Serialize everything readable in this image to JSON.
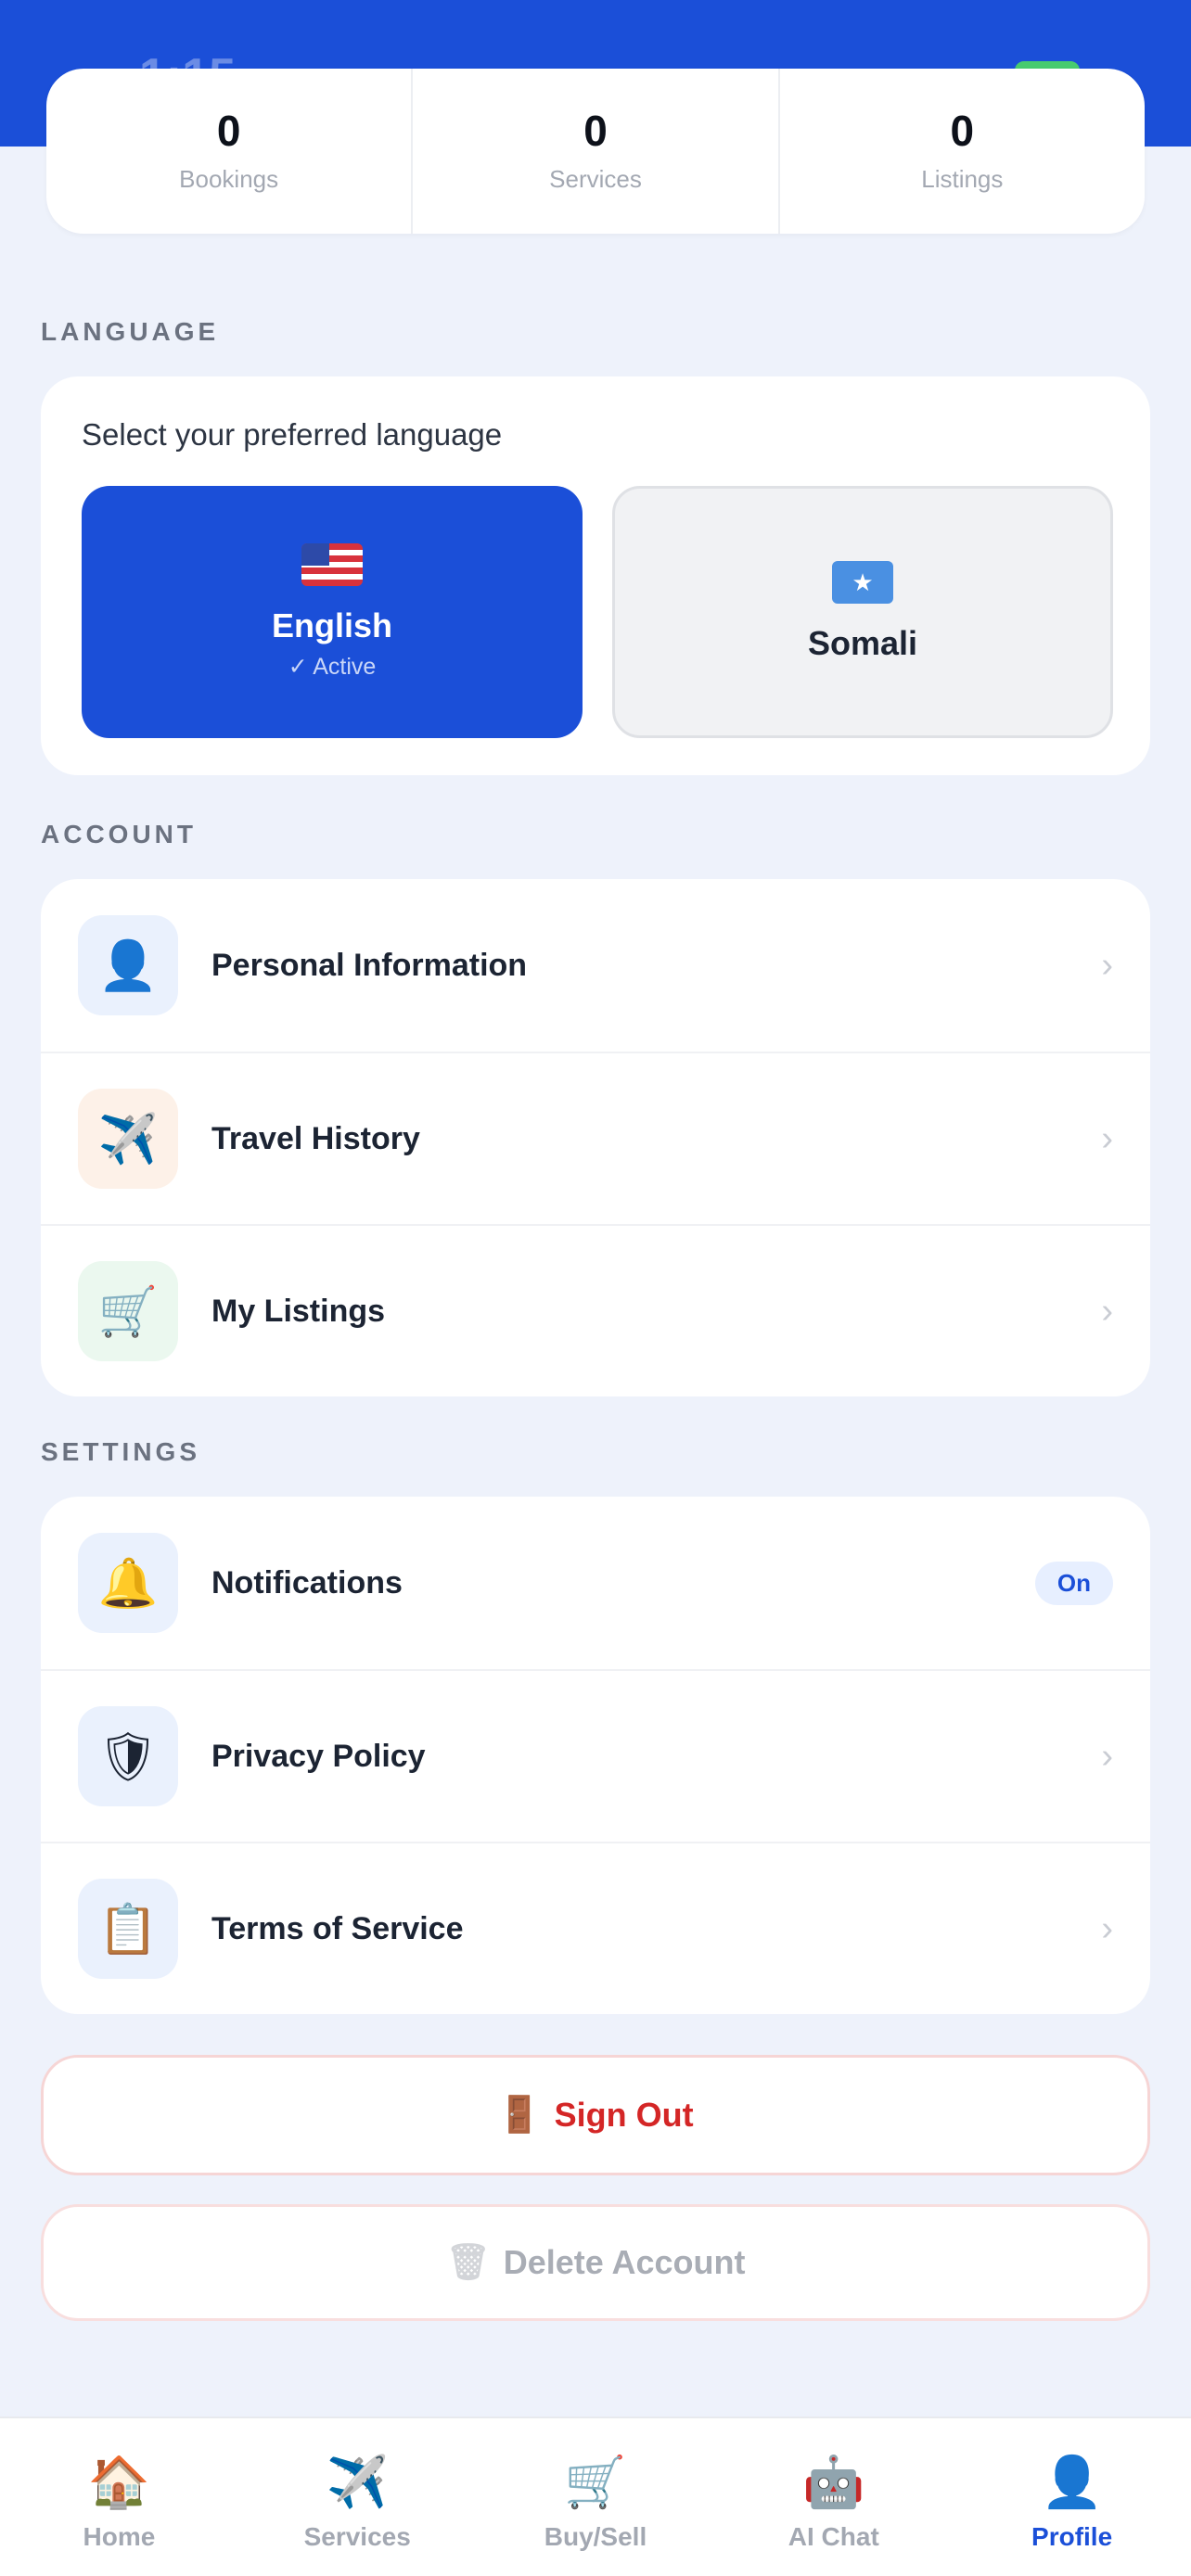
{
  "status_bar": {
    "time": "1:15"
  },
  "stats": [
    {
      "value": "0",
      "label": "Bookings"
    },
    {
      "value": "0",
      "label": "Services"
    },
    {
      "value": "0",
      "label": "Listings"
    }
  ],
  "language": {
    "section_label": "LANGUAGE",
    "prompt": "Select your preferred language",
    "options": [
      {
        "name": "English",
        "status": "✓ Active",
        "flag": "us-flag-icon"
      },
      {
        "name": "Somali",
        "flag": "somalia-flag-icon"
      }
    ]
  },
  "account": {
    "section_label": "ACCOUNT",
    "items": [
      {
        "label": "Personal Information",
        "icon": "👤",
        "icon_name": "person-icon"
      },
      {
        "label": "Travel History",
        "icon": "✈️",
        "icon_name": "airplane-icon"
      },
      {
        "label": "My Listings",
        "icon": "🛒",
        "icon_name": "cart-icon"
      }
    ]
  },
  "settings": {
    "section_label": "SETTINGS",
    "items": [
      {
        "label": "Notifications",
        "icon": "🔔",
        "icon_name": "bell-icon",
        "badge": "On"
      },
      {
        "label": "Privacy Policy",
        "icon": "🛡",
        "icon_name": "shield-icon"
      },
      {
        "label": "Terms of Service",
        "icon": "📋",
        "icon_name": "clipboard-icon"
      }
    ]
  },
  "actions": {
    "sign_out": {
      "label": "Sign Out",
      "icon": "🚪"
    },
    "delete_account": {
      "label": "Delete Account",
      "icon": "🗑"
    }
  },
  "tabs": [
    {
      "label": "Home",
      "icon": "🏠",
      "active": false
    },
    {
      "label": "Services",
      "icon": "✈️",
      "active": false
    },
    {
      "label": "Buy/Sell",
      "icon": "🛒",
      "active": false
    },
    {
      "label": "AI Chat",
      "icon": "🤖",
      "active": false
    },
    {
      "label": "Profile",
      "icon": "👤",
      "active": true
    }
  ],
  "colors": {
    "primary": "#1b4fd8",
    "background": "#eef2fb",
    "danger": "#d42626",
    "muted": "#a3a8b2"
  }
}
